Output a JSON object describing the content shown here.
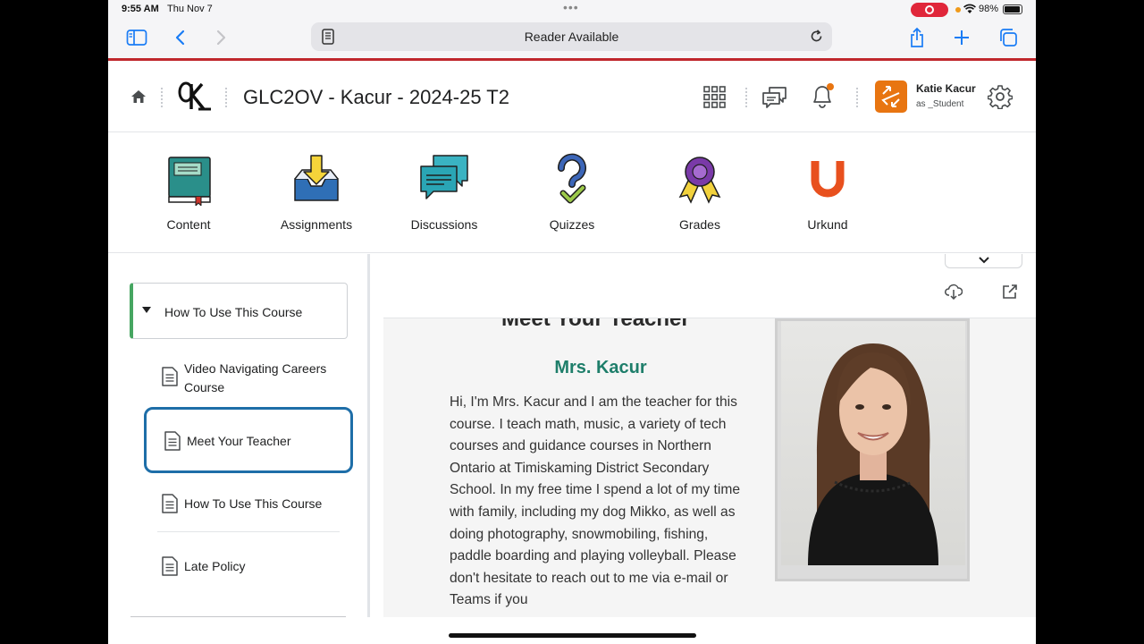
{
  "status_bar": {
    "time": "9:55 AM",
    "date": "Thu Nov 7",
    "battery": "98%"
  },
  "browser": {
    "url_text": "Reader Available",
    "icons": [
      "sidebar-icon",
      "back-icon",
      "forward-icon",
      "reader-icon",
      "reload-icon",
      "share-icon",
      "new-tab-icon",
      "tabs-icon"
    ],
    "accent_color": "#1a7cf5"
  },
  "header": {
    "course_title": "GLC2OV - Kacur - 2024-25 T2",
    "user_name": "Katie Kacur",
    "user_role": "as _Student",
    "avatar_color": "#e87511",
    "accent_line_color": "#c0272d"
  },
  "navbar": {
    "tools": [
      {
        "label": "Content",
        "icon": "book-icon"
      },
      {
        "label": "Assignments",
        "icon": "inbox-tray-icon"
      },
      {
        "label": "Discussions",
        "icon": "chat-bubbles-icon"
      },
      {
        "label": "Quizzes",
        "icon": "question-check-icon"
      },
      {
        "label": "Grades",
        "icon": "ribbon-award-icon"
      },
      {
        "label": "Urkund",
        "icon": "urkund-u-icon"
      }
    ]
  },
  "toc": {
    "module_title": "How To Use This Course",
    "items": [
      {
        "label": "Video Navigating Careers Course",
        "active": false
      },
      {
        "label": "Meet Your Teacher",
        "active": true
      },
      {
        "label": "How To Use This Course",
        "active": false
      },
      {
        "label": "Late Policy",
        "active": false
      }
    ]
  },
  "document": {
    "heading": "Meet Your Teacher",
    "teacher_name": "Mrs. Kacur",
    "bio": "Hi, I'm Mrs. Kacur and I am the teacher for this course. I teach math, music, a variety of tech courses and guidance courses in Northern Ontario at Timiskaming District Secondary School. In my free time I spend a lot of my time with family, including my dog Mikko, as well as doing photography, snowmobiling, fishing, paddle boarding and playing volleyball. Please don't hesitate to reach out to me via e-mail or Teams if you"
  }
}
